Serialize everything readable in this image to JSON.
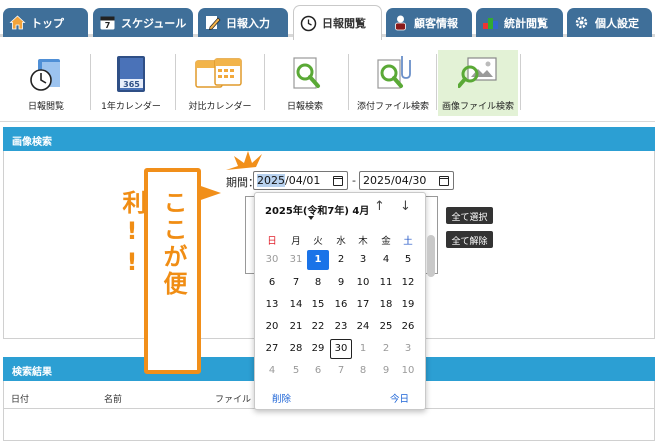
{
  "tabs": [
    {
      "label": "トップ",
      "icon": "home-icon"
    },
    {
      "label": "スケジュール",
      "icon": "calendar-icon"
    },
    {
      "label": "日報入力",
      "icon": "pencil-icon"
    },
    {
      "label": "日報閲覧",
      "icon": "clock-icon",
      "active": true
    },
    {
      "label": "顧客情報",
      "icon": "customer-icon"
    },
    {
      "label": "統計閲覧",
      "icon": "stats-icon"
    },
    {
      "label": "個人設定",
      "icon": "gear-icon"
    }
  ],
  "subnav": [
    {
      "label": "日報閲覧",
      "icon": "clock-folder-icon"
    },
    {
      "label": "1年カレンダー",
      "icon": "year-calendar-icon"
    },
    {
      "label": "対比カレンダー",
      "icon": "compare-calendar-icon"
    },
    {
      "label": "日報検索",
      "icon": "search-document-icon"
    },
    {
      "label": "添付ファイル検索",
      "icon": "attachment-search-icon"
    },
    {
      "label": "画像ファイル検索",
      "icon": "image-search-icon",
      "active": true
    }
  ],
  "search_panel": {
    "title": "画像検索",
    "period_label": "期間：",
    "date_from": "2025/04/01",
    "date_from_selected": "2025",
    "date_from_rest": "/04/01",
    "date_to": "2025/04/30",
    "separator": "-",
    "select_all_label": "全て選択",
    "deselect_all_label": "全て解除"
  },
  "calendar": {
    "title": "2025年(令和7年) 4月",
    "weekdays": [
      "日",
      "月",
      "火",
      "水",
      "木",
      "金",
      "土"
    ],
    "weekday_colors": {
      "sun": "#e0212c",
      "sat": "#1a4fc4"
    },
    "weeks": [
      [
        "30",
        "31",
        "1",
        "2",
        "3",
        "4",
        "5"
      ],
      [
        "6",
        "7",
        "8",
        "9",
        "10",
        "11",
        "12"
      ],
      [
        "13",
        "14",
        "15",
        "16",
        "17",
        "18",
        "19"
      ],
      [
        "20",
        "21",
        "22",
        "23",
        "24",
        "25",
        "26"
      ],
      [
        "27",
        "28",
        "29",
        "30",
        "1",
        "2",
        "3"
      ],
      [
        "4",
        "5",
        "6",
        "7",
        "8",
        "9",
        "10"
      ]
    ],
    "selected_day": "1",
    "today_day": "30",
    "clear_label": "削除",
    "today_label": "今日"
  },
  "results_panel": {
    "title": "検索結果",
    "columns": [
      "日付",
      "名前",
      "ファイル"
    ]
  },
  "annotation": {
    "text": "ここが便利!!",
    "color": "#f18f1a"
  }
}
